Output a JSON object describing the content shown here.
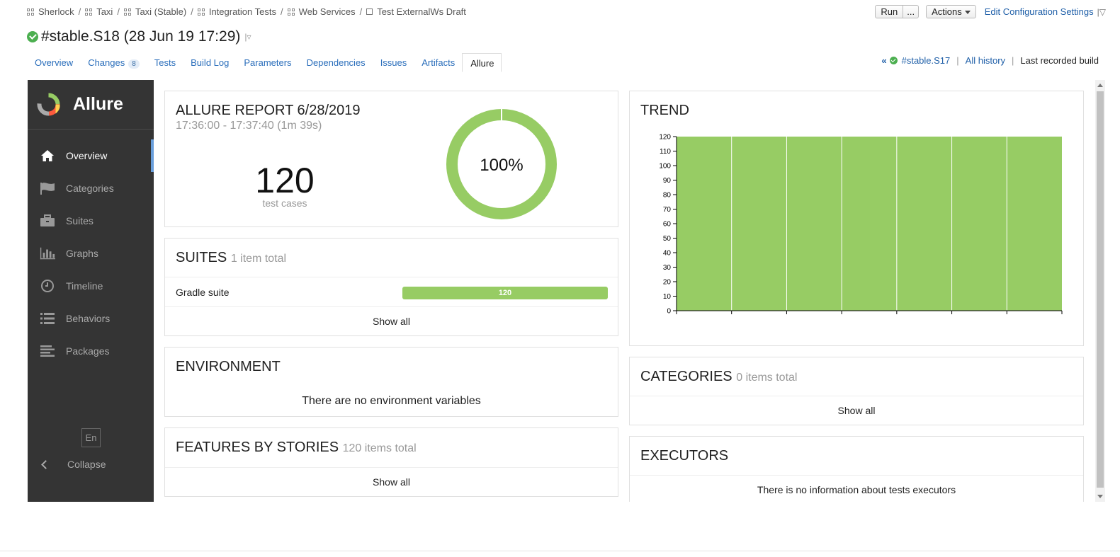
{
  "breadcrumb": [
    {
      "label": "Sherlock",
      "icon": "grid-icon"
    },
    {
      "label": "Taxi",
      "icon": "grid-icon"
    },
    {
      "label": "Taxi (Stable)",
      "icon": "grid-icon"
    },
    {
      "label": "Integration Tests",
      "icon": "grid-icon"
    },
    {
      "label": "Web Services",
      "icon": "grid-icon"
    },
    {
      "label": "Test ExternalWs Draft",
      "icon": "square-icon"
    }
  ],
  "breadcrumb_separator": "/",
  "top_actions": {
    "run_label": "Run",
    "run_more_label": "...",
    "actions_label": "Actions",
    "edit_config_label": "Edit Configuration Settings",
    "edit_config_more": "|▽"
  },
  "build": {
    "title": "#stable.S18 (28 Jun 19 17:29)",
    "dropdown": "|▿",
    "status_color": "#4caf50"
  },
  "tabs": [
    {
      "label": "Overview"
    },
    {
      "label": "Changes",
      "badge": "8"
    },
    {
      "label": "Tests"
    },
    {
      "label": "Build Log"
    },
    {
      "label": "Parameters"
    },
    {
      "label": "Dependencies"
    },
    {
      "label": "Issues"
    },
    {
      "label": "Artifacts"
    },
    {
      "label": "Allure",
      "active": true
    }
  ],
  "history": {
    "prev_arrows": "«",
    "prev_build": "#stable.S17",
    "sep": "|",
    "all_history": "All history",
    "last_recorded": "Last recorded build"
  },
  "allure": {
    "logo_text": "Allure",
    "nav": [
      {
        "label": "Overview",
        "icon": "home-icon",
        "active": true
      },
      {
        "label": "Categories",
        "icon": "flag-icon"
      },
      {
        "label": "Suites",
        "icon": "briefcase-icon"
      },
      {
        "label": "Graphs",
        "icon": "bar-chart-icon"
      },
      {
        "label": "Timeline",
        "icon": "clock-icon"
      },
      {
        "label": "Behaviors",
        "icon": "list-icon"
      },
      {
        "label": "Packages",
        "icon": "align-left-icon"
      }
    ],
    "lang": "En",
    "collapse_label": "Collapse"
  },
  "report": {
    "title": "ALLURE REPORT 6/28/2019",
    "time": "17:36:00 - 17:37:40 (1m 39s)",
    "count": "120",
    "count_label": "test cases",
    "percent": "100%",
    "pass_fraction": 1.0,
    "pass_color": "#97cc64"
  },
  "suites": {
    "title": "SUITES",
    "subtitle": "1 item total",
    "rows": [
      {
        "name": "Gradle suite",
        "passed": "120"
      }
    ],
    "show_all": "Show all"
  },
  "environment": {
    "title": "ENVIRONMENT",
    "empty": "There are no environment variables"
  },
  "features": {
    "title": "FEATURES BY STORIES",
    "subtitle": "120 items total",
    "show_all": "Show all"
  },
  "trend": {
    "title": "TREND"
  },
  "categories": {
    "title": "CATEGORIES",
    "subtitle": "0 items total",
    "show_all": "Show all"
  },
  "executors": {
    "title": "EXECUTORS",
    "empty": "There is no information about tests executors"
  },
  "chart_data": {
    "type": "area",
    "title": "TREND",
    "x": [
      1,
      2,
      3,
      4,
      5,
      6,
      7,
      8
    ],
    "series": [
      {
        "values": [
          120,
          120,
          120,
          120,
          120,
          120,
          120,
          120
        ],
        "color": "#97cc64"
      }
    ],
    "yticks": [
      0,
      10,
      20,
      30,
      40,
      50,
      60,
      70,
      80,
      90,
      100,
      110,
      120
    ],
    "ylim": [
      0,
      120
    ],
    "grid": false
  }
}
